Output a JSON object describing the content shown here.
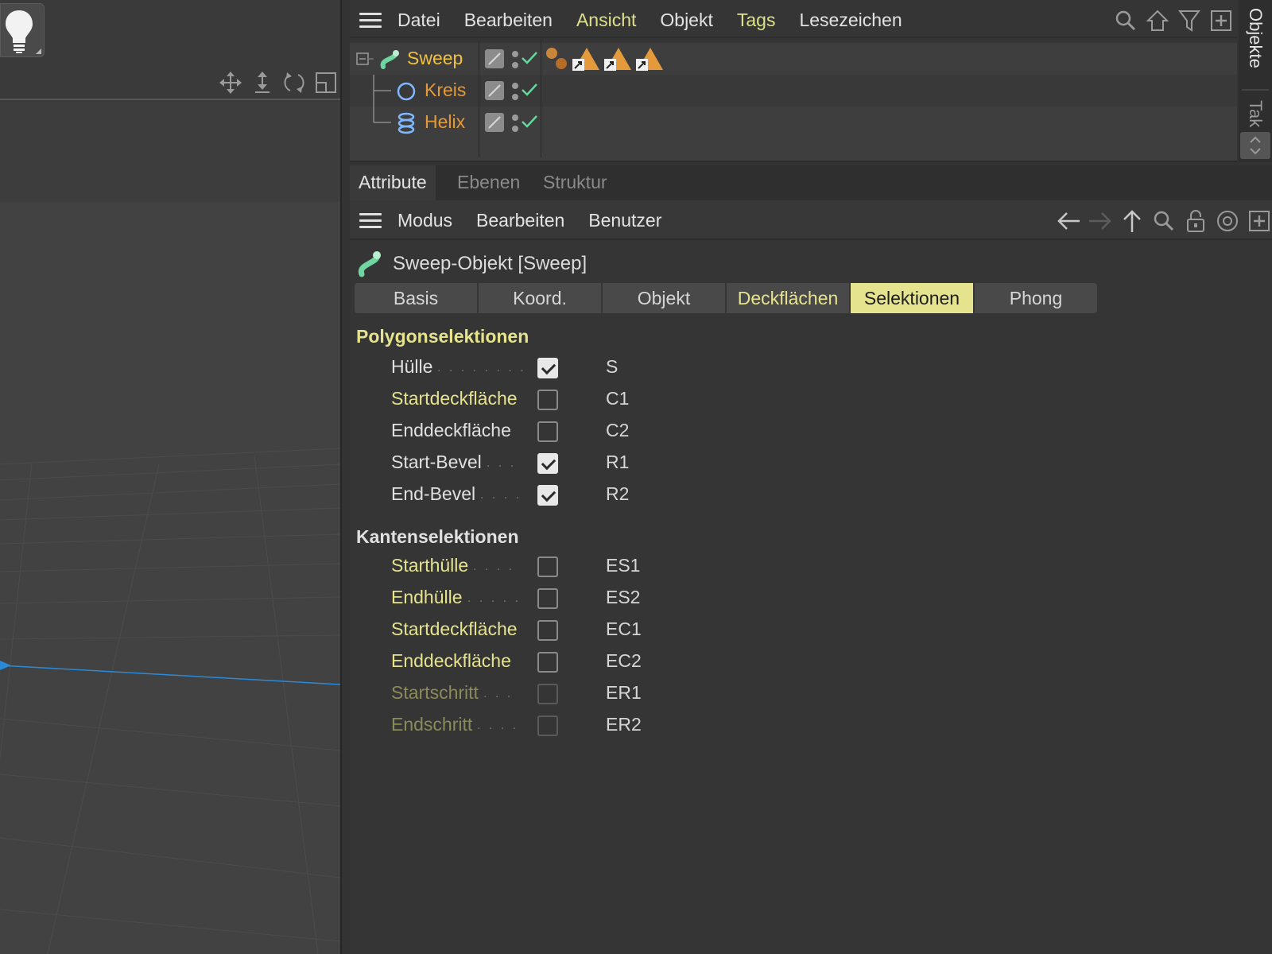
{
  "object_manager": {
    "menu": [
      {
        "label": "Datei",
        "highlight": false
      },
      {
        "label": "Bearbeiten",
        "highlight": false
      },
      {
        "label": "Ansicht",
        "highlight": true
      },
      {
        "label": "Objekt",
        "highlight": false
      },
      {
        "label": "Tags",
        "highlight": true
      },
      {
        "label": "Lesezeichen",
        "highlight": false
      }
    ],
    "icons": [
      "search-icon",
      "home-icon",
      "filter-icon",
      "new-window-icon"
    ],
    "objects": [
      {
        "name": "Sweep",
        "color": "#f0c040",
        "icon": "sweep-icon"
      },
      {
        "name": "Kreis",
        "color": "#e49a3a",
        "icon": "circle-spline-icon"
      },
      {
        "name": "Helix",
        "color": "#e49a3a",
        "icon": "helix-spline-icon"
      }
    ]
  },
  "side_tabs": {
    "objects": "Objekte",
    "takes": "Tak"
  },
  "attribute_manager": {
    "tabs": [
      {
        "label": "Attribute",
        "active": true
      },
      {
        "label": "Ebenen",
        "active": false
      },
      {
        "label": "Struktur",
        "active": false
      }
    ],
    "menu": [
      "Modus",
      "Bearbeiten",
      "Benutzer"
    ],
    "icons": [
      "back-arrow-icon",
      "forward-arrow-icon",
      "up-arrow-icon",
      "search-icon",
      "lock-icon",
      "target-icon",
      "new-window-icon"
    ],
    "object_title": "Sweep-Objekt [Sweep]",
    "subtabs": [
      {
        "label": "Basis",
        "state": "normal"
      },
      {
        "label": "Koord.",
        "state": "normal"
      },
      {
        "label": "Objekt",
        "state": "normal"
      },
      {
        "label": "Deckflächen",
        "state": "highlight"
      },
      {
        "label": "Selektionen",
        "state": "active"
      },
      {
        "label": "Phong",
        "state": "normal"
      }
    ],
    "polygon_section": "Polygonselektionen",
    "polygon_rows": [
      {
        "label": "Hülle",
        "dots": ". . . . . . . .",
        "checked": true,
        "value": "S",
        "style": "white"
      },
      {
        "label": "Startdeckfläche",
        "dots": "",
        "checked": false,
        "value": "C1",
        "style": "yellow"
      },
      {
        "label": "Enddeckfläche",
        "dots": "",
        "checked": false,
        "value": "C2",
        "style": "white"
      },
      {
        "label": "Start-Bevel",
        "dots": ". . .",
        "checked": true,
        "value": "R1",
        "style": "white"
      },
      {
        "label": "End-Bevel",
        "dots": ". . . .",
        "checked": true,
        "value": "R2",
        "style": "white"
      }
    ],
    "edge_section": "Kantenselektionen",
    "edge_rows": [
      {
        "label": "Starthülle",
        "dots": ". . . .",
        "checked": false,
        "value": "ES1",
        "style": "yellow"
      },
      {
        "label": "Endhülle",
        "dots": ". . . . .",
        "checked": false,
        "value": "ES2",
        "style": "yellow"
      },
      {
        "label": "Startdeckfläche",
        "dots": "",
        "checked": false,
        "value": "EC1",
        "style": "yellow"
      },
      {
        "label": "Enddeckfläche",
        "dots": "",
        "checked": false,
        "value": "EC2",
        "style": "yellow"
      },
      {
        "label": "Startschritt",
        "dots": ". . .",
        "checked": false,
        "value": "ER1",
        "style": "dim"
      },
      {
        "label": "Endschritt",
        "dots": ". . . .",
        "checked": false,
        "value": "ER2",
        "style": "dim"
      }
    ]
  }
}
